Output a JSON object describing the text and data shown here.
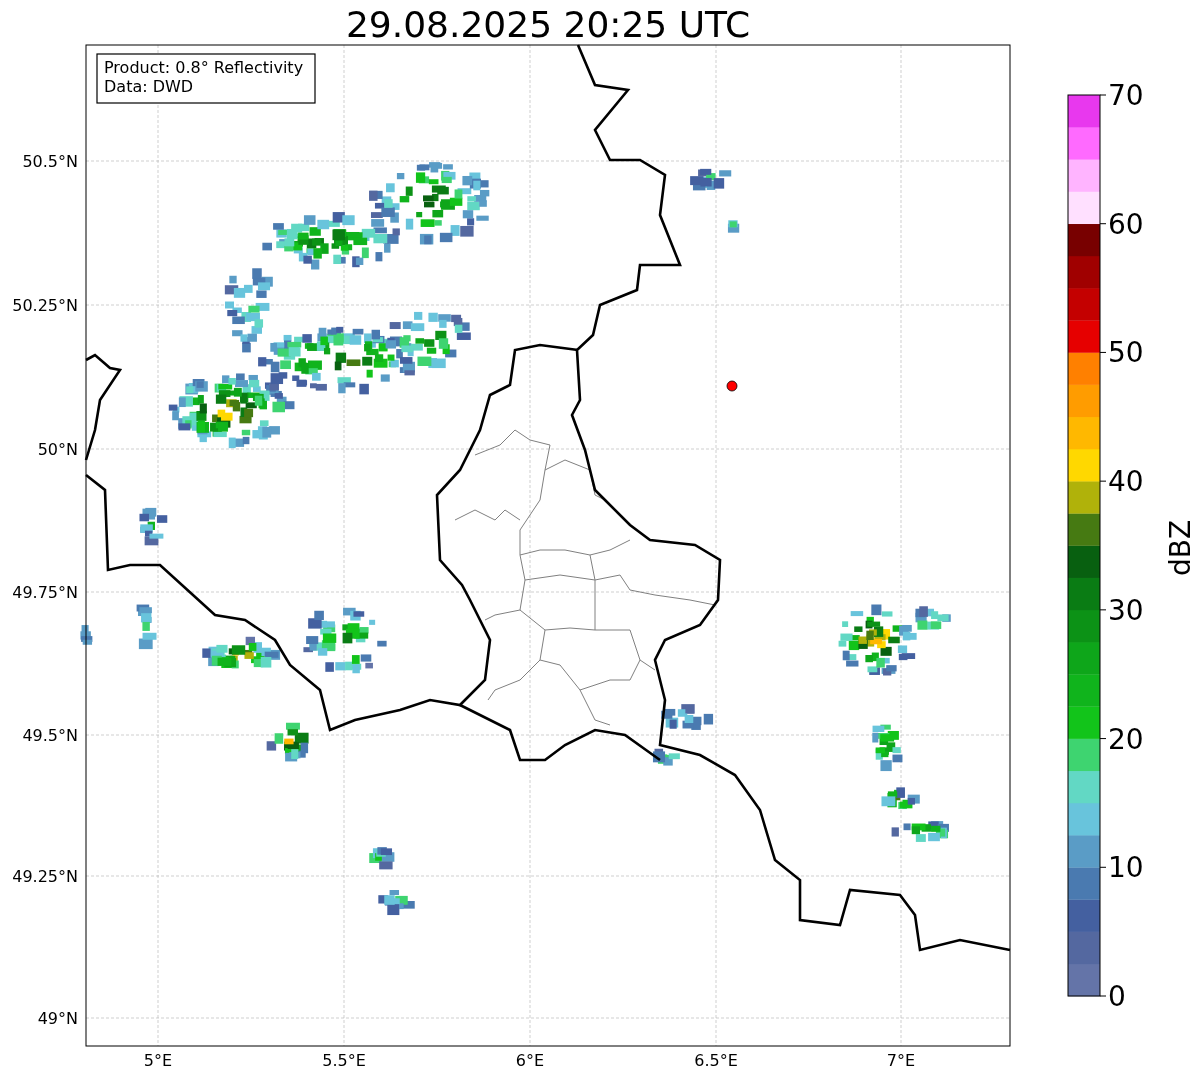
{
  "title": "29.08.2025 20:25 UTC",
  "info_box": [
    "Product: 0.8° Reflectivity",
    "Data: DWD"
  ],
  "lat_ticks": [
    "50.5°N",
    "50.25°N",
    "50°N",
    "49.75°N",
    "49.5°N",
    "49.25°N",
    "49°N"
  ],
  "lon_ticks": [
    "5°E",
    "5.5°E",
    "6°E",
    "6.5°E",
    "7°E"
  ],
  "colorbar": {
    "label": "dBZ",
    "ticks": [
      "70",
      "60",
      "50",
      "40",
      "30",
      "20",
      "10",
      "0"
    ],
    "bands": [
      {
        "color": "#6474a8"
      },
      {
        "color": "#5468a0"
      },
      {
        "color": "#4460a0"
      },
      {
        "color": "#4a7ab0"
      },
      {
        "color": "#5a9cc6"
      },
      {
        "color": "#68c4dc"
      },
      {
        "color": "#62d8c4"
      },
      {
        "color": "#3ed470"
      },
      {
        "color": "#12c41a"
      },
      {
        "color": "#10b41c"
      },
      {
        "color": "#0ea61a"
      },
      {
        "color": "#0c9216"
      },
      {
        "color": "#0a7c14"
      },
      {
        "color": "#086010"
      },
      {
        "color": "#467a12"
      },
      {
        "color": "#b0b20a"
      },
      {
        "color": "#ffd800"
      },
      {
        "color": "#ffb800"
      },
      {
        "color": "#ff9c00"
      },
      {
        "color": "#ff8000"
      },
      {
        "color": "#e60000"
      },
      {
        "color": "#c40000"
      },
      {
        "color": "#a00000"
      },
      {
        "color": "#780000"
      },
      {
        "color": "#ffe0ff"
      },
      {
        "color": "#ffb4ff"
      },
      {
        "color": "#ff6aff"
      },
      {
        "color": "#e838ee"
      }
    ]
  }
}
